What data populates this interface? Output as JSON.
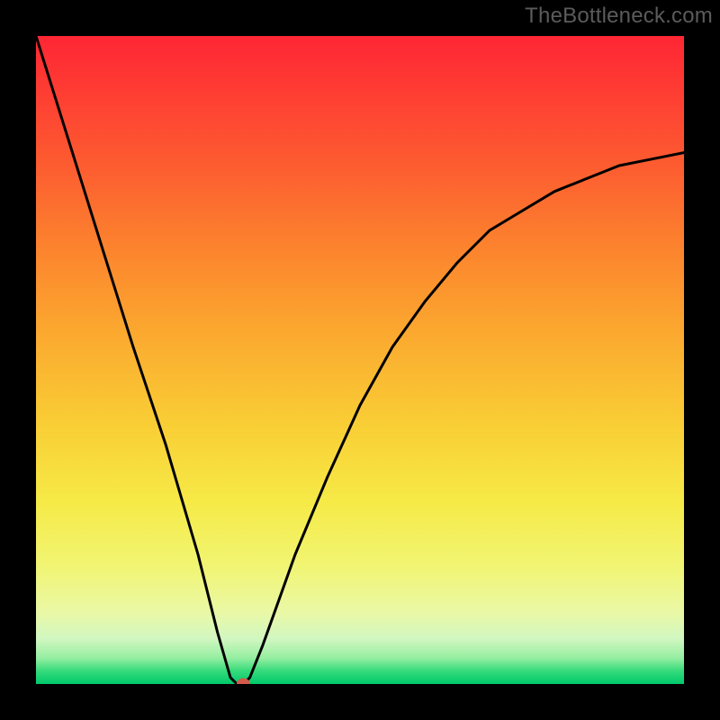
{
  "watermark": {
    "text": "TheBottleneck.com"
  },
  "colors": {
    "background": "#000000",
    "curve": "#000000",
    "marker": "#d45a4a",
    "gradient_stops": [
      "#fe2634",
      "#fe3b33",
      "#fd5c30",
      "#fc842e",
      "#fba92f",
      "#f9ce35",
      "#f6ea47",
      "#f1f574",
      "#eaf8a6",
      "#d1f7c1",
      "#95eea1",
      "#35db7b",
      "#00c96b"
    ]
  },
  "chart_data": {
    "type": "line",
    "title": "",
    "xlabel": "",
    "ylabel": "",
    "xlim": [
      0,
      100
    ],
    "ylim": [
      0,
      100
    ],
    "grid": false,
    "legend": false,
    "series": [
      {
        "name": "bottleneck-curve",
        "x": [
          0,
          5,
          10,
          15,
          20,
          25,
          28,
          30,
          31,
          32,
          33,
          35,
          40,
          45,
          50,
          55,
          60,
          65,
          70,
          75,
          80,
          85,
          90,
          95,
          100
        ],
        "y": [
          100,
          84,
          68,
          52,
          37,
          20,
          8,
          1,
          0,
          0,
          1,
          6,
          20,
          32,
          43,
          52,
          59,
          65,
          70,
          73,
          76,
          78,
          80,
          81,
          82
        ]
      }
    ],
    "marker": {
      "x": 32,
      "y": 0,
      "label": ""
    }
  }
}
